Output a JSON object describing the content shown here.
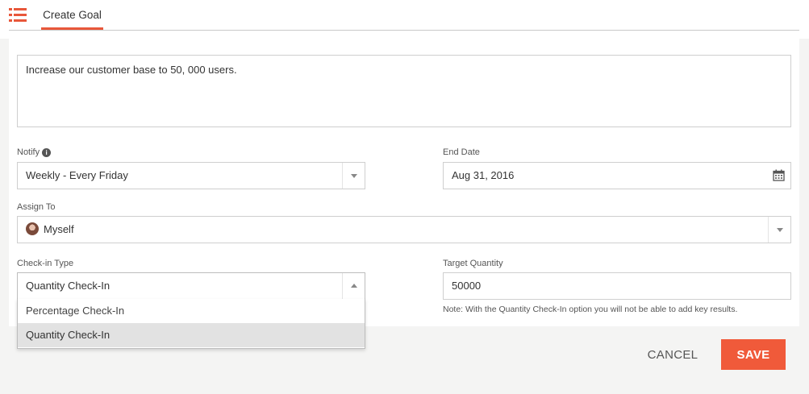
{
  "header": {
    "menu_icon": "list-icon",
    "tab_label": "Create Goal"
  },
  "goal": {
    "text": "Increase our customer base to 50, 000 users."
  },
  "notify": {
    "label": "Notify",
    "info_icon": "info-icon",
    "value": "Weekly - Every Friday"
  },
  "end_date": {
    "label": "End Date",
    "value": "Aug 31, 2016",
    "icon": "calendar-icon"
  },
  "assign_to": {
    "label": "Assign To",
    "value": "Myself"
  },
  "checkin_type": {
    "label": "Check-in Type",
    "value": "Quantity Check-In",
    "options": [
      "Percentage Check-In",
      "Quantity Check-In"
    ],
    "selected_option": "Quantity Check-In"
  },
  "target_quantity": {
    "label": "Target Quantity",
    "value": "50000",
    "note": "Note: With the Quantity Check-In option you will not be able to add key results."
  },
  "footer": {
    "cancel_label": "CANCEL",
    "save_label": "SAVE"
  },
  "colors": {
    "accent": "#e8573a",
    "save_button": "#f05a3a",
    "background": "#f4f4f3"
  }
}
